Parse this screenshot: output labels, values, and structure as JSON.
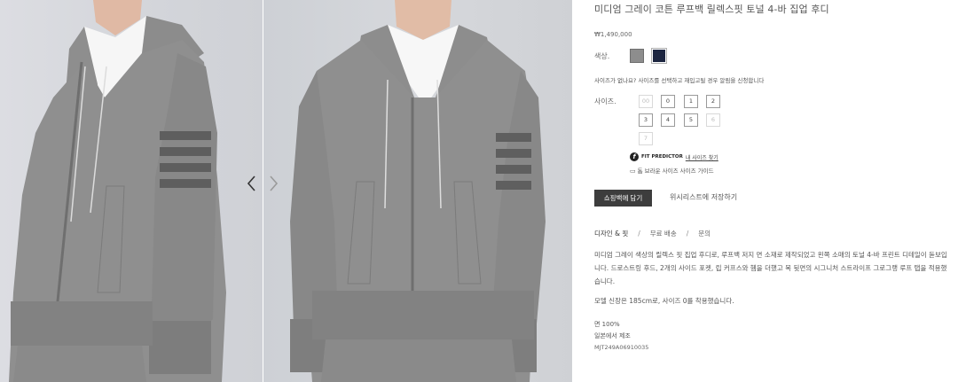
{
  "gallery": {
    "image1_alt": "side view product photo",
    "image2_alt": "front view product photo",
    "prev_icon": "chevron-left-icon",
    "next_icon": "chevron-right-icon"
  },
  "product": {
    "title": "미디엄 그레이 코튼 루프백 릴렉스핏 토널 4-바 집업 후디",
    "price": "₩1,490,000",
    "color_label": "색상.",
    "colors": [
      {
        "name": "grey",
        "hex": "#8d8d8d"
      },
      {
        "name": "navy",
        "hex": "#1c2540"
      }
    ],
    "size_note": "사이즈가 없나요? 사이즈를 선택하고 재입고될 경우 알림을 신청합니다",
    "size_label": "사이즈.",
    "sizes": [
      {
        "label": "00",
        "available": false
      },
      {
        "label": "0",
        "available": true
      },
      {
        "label": "1",
        "available": true
      },
      {
        "label": "2",
        "available": true
      },
      {
        "label": "3",
        "available": true
      },
      {
        "label": "4",
        "available": true
      },
      {
        "label": "5",
        "available": true
      },
      {
        "label": "6",
        "available": false
      },
      {
        "label": "7",
        "available": false
      }
    ],
    "fit_predictor": {
      "logo": "f",
      "brand": "FIT PREDICTOR",
      "link": "내 사이즈 찾기"
    },
    "size_guide": {
      "icon": "ruler-icon",
      "label": "톰 브라운 사이즈 사이즈 가이드"
    },
    "cart_button": "쇼핑백에 담기",
    "wishlist_button": "위시리스트에 저장하기",
    "tabs": [
      "디자인 & 핏",
      "무료 배송",
      "문의"
    ],
    "tab_separator": "/",
    "description": "미디엄 그레이 색상의 릴렉스 핏 집업 후디로, 루프백 저지 면 소재로 제작되었고 왼쪽 소매의 토널 4-바 프린트 디테일이 돋보입니다. 드로스트링 후드, 2개의 사이드 포켓, 립 커프스와 헴을 더했고 목 뒷면의 시그니처 스트라이프 그로그랭 루프 탭을 적용했습니다.",
    "model_info": "모델 신장은 185cm로, 사이즈 0를 착용했습니다.",
    "material": "면 100%",
    "origin": "일본에서 제조",
    "sku": "MJT249A06910035"
  }
}
